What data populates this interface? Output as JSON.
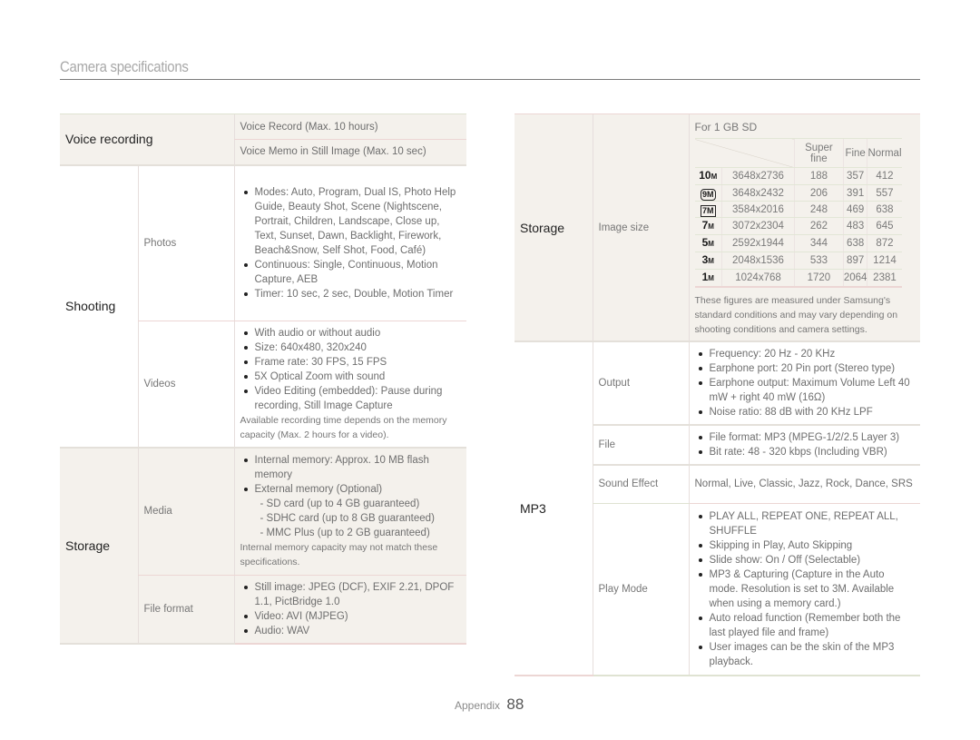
{
  "header": {
    "title": "Camera specifications"
  },
  "left_table": {
    "voice_recording": {
      "category": "Voice recording",
      "items": [
        "Voice Record (Max. 10 hours)",
        "Voice Memo in Still Image (Max. 10 sec)"
      ]
    },
    "shooting": {
      "category": "Shooting",
      "photos": {
        "label": "Photos",
        "bullets": [
          "Modes: Auto, Program, Dual IS, Photo Help Guide, Beauty Shot, Scene (Nightscene, Portrait, Children, Landscape, Close up, Text, Sunset, Dawn, Backlight, Firework, Beach&Snow, Self Shot, Food, Café)",
          "Continuous: Single, Continuous, Motion Capture, AEB",
          "Timer: 10 sec, 2 sec, Double, Motion Timer"
        ]
      },
      "videos": {
        "label": "Videos",
        "bullets": [
          "With audio or without audio",
          "Size: 640x480, 320x240",
          "Frame rate: 30 FPS, 15 FPS",
          "5X Optical Zoom with sound",
          "Video Editing (embedded): Pause during recording, Still Image Capture"
        ],
        "note": "Available recording time depends on the memory capacity (Max. 2 hours for a video)."
      }
    },
    "storage": {
      "category": "Storage",
      "media": {
        "label": "Media",
        "bullets": [
          "Internal memory: Approx. 10 MB flash memory",
          "External memory (Optional)"
        ],
        "sub_items": [
          "- SD card (up to 4 GB guaranteed)",
          "- SDHC card (up to 8 GB guaranteed)",
          "- MMC Plus (up to 2 GB guaranteed)"
        ],
        "note": "Internal memory capacity may not match these specifications."
      },
      "file_format": {
        "label": "File format",
        "bullets": [
          "Still image: JPEG (DCF), EXIF 2.21, DPOF 1.1, PictBridge 1.0",
          "Video: AVI (MJPEG)",
          "Audio: WAV"
        ]
      }
    }
  },
  "right_table": {
    "storage": {
      "category": "Storage",
      "image_size": {
        "label": "Image size",
        "caption": "For 1 GB SD",
        "columns": [
          "Super fine",
          "Fine",
          "Normal"
        ],
        "rows": [
          {
            "icon": "10M",
            "icon_name": "10m-size-icon",
            "resolution": "3648x2736",
            "super_fine": "188",
            "fine": "357",
            "normal": "412"
          },
          {
            "icon": "9M",
            "icon_name": "9m-wide-size-icon",
            "resolution": "3648x2432",
            "super_fine": "206",
            "fine": "391",
            "normal": "557"
          },
          {
            "icon": "7M",
            "icon_name": "7m-widescreen-size-icon",
            "resolution": "3584x2016",
            "super_fine": "248",
            "fine": "469",
            "normal": "638"
          },
          {
            "icon": "7M",
            "icon_name": "7m-size-icon",
            "resolution": "3072x2304",
            "super_fine": "262",
            "fine": "483",
            "normal": "645"
          },
          {
            "icon": "5M",
            "icon_name": "5m-size-icon",
            "resolution": "2592x1944",
            "super_fine": "344",
            "fine": "638",
            "normal": "872"
          },
          {
            "icon": "3M",
            "icon_name": "3m-size-icon",
            "resolution": "2048x1536",
            "super_fine": "533",
            "fine": "897",
            "normal": "1214"
          },
          {
            "icon": "1M",
            "icon_name": "1m-size-icon",
            "resolution": "1024x768",
            "super_fine": "1720",
            "fine": "2064",
            "normal": "2381"
          }
        ],
        "note": "These figures are measured under Samsung's standard conditions and may vary depending on shooting conditions and camera settings."
      }
    },
    "mp3": {
      "category": "MP3",
      "output": {
        "label": "Output",
        "bullets": [
          "Frequency: 20 Hz - 20 KHz",
          "Earphone port: 20 Pin port (Stereo type)",
          "Earphone output: Maximum Volume Left 40 mW + right 40 mW (16Ω)",
          "Noise ratio: 88 dB with 20 KHz LPF"
        ]
      },
      "file": {
        "label": "File",
        "bullets": [
          "File format: MP3 (MPEG-1/2/2.5 Layer 3)",
          "Bit rate: 48 - 320 kbps (Including VBR)"
        ]
      },
      "sound_effect": {
        "label": "Sound Effect",
        "text": "Normal, Live, Classic, Jazz, Rock, Dance, SRS"
      },
      "play_mode": {
        "label": "Play Mode",
        "bullets": [
          "PLAY ALL, REPEAT ONE, REPEAT ALL, SHUFFLE",
          "Skipping in Play, Auto Skipping",
          "Slide show: On / Off (Selectable)",
          "MP3 & Capturing (Capture in the Auto mode. Resolution is set to 3M. Available when using a memory card.)",
          "Auto reload function (Remember both the last played file and frame)",
          "User images can be the skin of the MP3 playback."
        ]
      }
    }
  },
  "footer": {
    "section": "Appendix",
    "page": "88"
  }
}
